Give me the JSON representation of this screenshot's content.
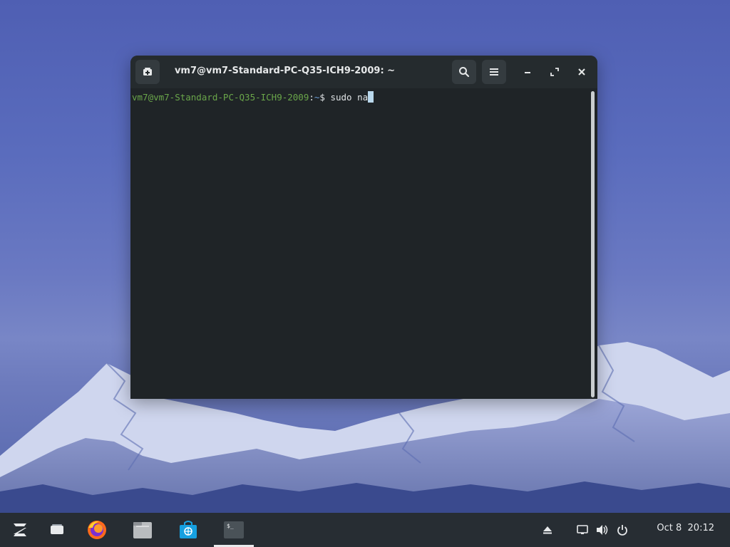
{
  "window": {
    "title": "vm7@vm7-Standard-PC-Q35-ICH9-2009: ~",
    "prompt_user_host": "vm7@vm7-Standard-PC-Q35-ICH9-2009",
    "prompt_sep": ":",
    "prompt_path": "~",
    "prompt_symbol": "$ ",
    "command_text": "sudo na"
  },
  "taskbar": {
    "date": "Oct 8",
    "time": "20:12",
    "apps": [
      "zorin-menu-icon",
      "workspaces-icon",
      "firefox-icon",
      "files-icon",
      "software-store-icon",
      "terminal-icon"
    ]
  },
  "colors": {
    "prompt_user": "#6aa64a",
    "prompt_path": "#6d9fd8",
    "terminal_bg": "#1f2427",
    "taskbar_bg": "#272d33"
  }
}
